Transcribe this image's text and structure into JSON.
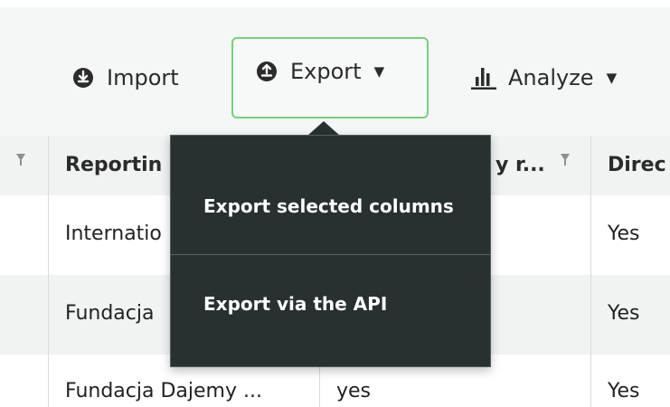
{
  "toolbar": {
    "import_label": "Import",
    "export_label": "Export",
    "analyze_label": "Analyze",
    "caret": "▼",
    "icons": [
      "download-circle-icon",
      "upload-circle-icon",
      "bar-chart-icon",
      "chevron-down-icon"
    ]
  },
  "table": {
    "columns": [
      {
        "label": "Reportin",
        "has_filter": true
      },
      {
        "label": "y r...",
        "has_filter": true
      },
      {
        "label": "Direc",
        "has_filter": false
      }
    ],
    "rows": [
      [
        "Internatio",
        "",
        "Yes"
      ],
      [
        "Fundacja",
        "",
        "Yes"
      ],
      [
        "Fundacja Dajemy ...",
        "yes",
        "Yes"
      ]
    ]
  },
  "export_menu": {
    "items": [
      "Export selected columns",
      "Export via the API"
    ]
  },
  "colors": {
    "toolbar_bg": "#f5f6f6",
    "export_highlight_border": "#77d07b",
    "menu_bg": "#283030",
    "header_bg": "#f1f3f3",
    "row_alt_bg": "#f1f3f3"
  }
}
